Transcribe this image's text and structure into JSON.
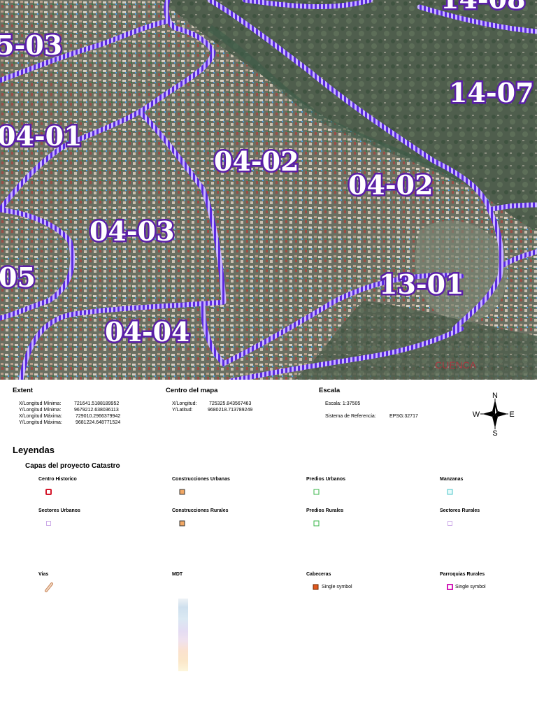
{
  "map": {
    "zone_labels": [
      "5-03",
      "14-08",
      "14-07",
      "04-01",
      "04-02",
      "04-02",
      "04-03",
      "05",
      "13-01",
      "04-04"
    ],
    "watermark": "CUENCA",
    "colors": {
      "boundary": "#6a2bd9",
      "label_outline": "#5a1fa8",
      "imagery_base": "#5d6b5c"
    }
  },
  "extent": {
    "title": "Extent",
    "rows": [
      {
        "label": "X/Longitud Mínima:",
        "value": "721641.5188189952"
      },
      {
        "label": "Y/Longitud Mínima:",
        "value": "9679212.638036113"
      },
      {
        "label": "X/Longitud Máxima:",
        "value": "729010.2966379942"
      },
      {
        "label": "Y/Longitud Máxima:",
        "value": "9681224.648771524"
      }
    ]
  },
  "centro": {
    "title": "Centro del mapa",
    "rows": [
      {
        "label": "X/Longitud:",
        "value": "725325.843567463"
      },
      {
        "label": "Y/Latitud:",
        "value": "9680218.713789249"
      }
    ]
  },
  "escala": {
    "title": "Escala",
    "scale_label": "Escala:",
    "scale_value": "1:37505",
    "srs_label": "Sistema de Referencia:",
    "srs_value": "EPSG:32717"
  },
  "compass": {
    "n": "N",
    "s": "S",
    "e": "E",
    "w": "W"
  },
  "legend": {
    "title": "Leyendas",
    "subtitle": "Capas del proyecto Catastro",
    "items": [
      {
        "name": "Centro Historico",
        "symbol": "square",
        "stroke": "#d4182b",
        "fill": "#ffffff"
      },
      {
        "name": "Construcciones Urbanas",
        "symbol": "square",
        "stroke": "#333333",
        "fill": "#f2a865"
      },
      {
        "name": "Predios Urbanos",
        "symbol": "square",
        "stroke": "#39b54a",
        "fill": "#ffffff"
      },
      {
        "name": "Manzanas",
        "symbol": "square",
        "stroke": "#49c6c9",
        "fill": "#e6fbfb"
      },
      {
        "name": "Sectores Urbanos",
        "symbol": "dotted",
        "stroke": "#9b59d0",
        "fill": "#ffffff"
      },
      {
        "name": "Construcciones Rurales",
        "symbol": "square",
        "stroke": "#333333",
        "fill": "#f2a865"
      },
      {
        "name": "Predios Rurales",
        "symbol": "square",
        "stroke": "#39b54a",
        "fill": "#ffffff"
      },
      {
        "name": "Sectores Rurales",
        "symbol": "dotted",
        "stroke": "#9b59d0",
        "fill": "#ffffff"
      },
      {
        "name": "Vias",
        "symbol": "line",
        "stroke": "#c8865a",
        "fill": "#f3d9c3"
      },
      {
        "name": "MDT",
        "symbol": "ramp",
        "stroke": "",
        "fill": ""
      },
      {
        "name": "Cabeceras",
        "symbol": "square-label",
        "stroke": "#6b2a00",
        "fill": "#e2571e",
        "label": "Single symbol"
      },
      {
        "name": "Parroquias Rurales",
        "symbol": "square-label",
        "stroke": "#d11fb8",
        "fill": "#ffffff",
        "label": "Single symbol"
      }
    ]
  }
}
